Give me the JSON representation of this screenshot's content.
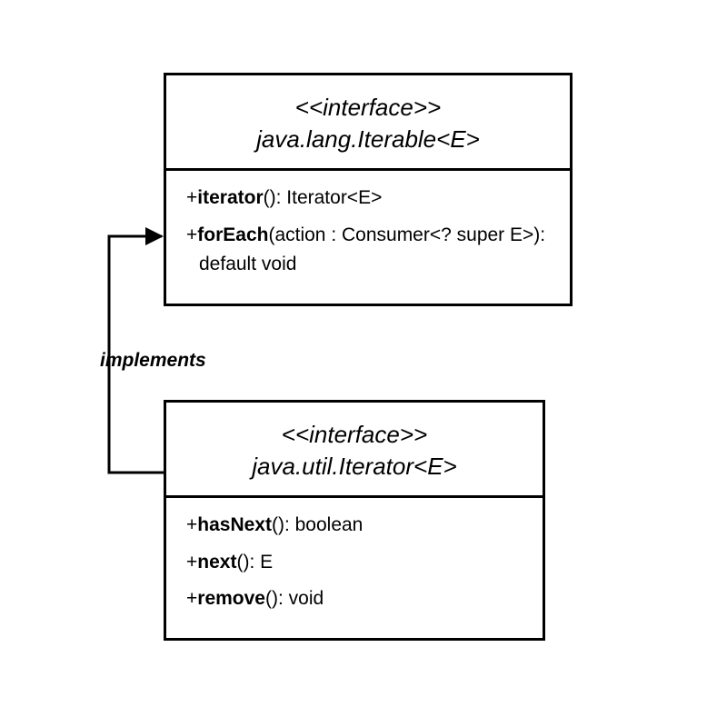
{
  "iterable": {
    "stereotype": "<<interface>>",
    "name": "java.lang.Iterable<E>",
    "methods": [
      {
        "prefix": "+",
        "name": "iterator",
        "sig": "(): Iterator<E>"
      },
      {
        "prefix": "+",
        "name": "forEach",
        "sig": "(action : Consumer<? super E>): default void"
      }
    ]
  },
  "iterator": {
    "stereotype": "<<interface>>",
    "name": "java.util.Iterator<E>",
    "methods": [
      {
        "prefix": "+",
        "name": "hasNext",
        "sig": "(): boolean"
      },
      {
        "prefix": "+",
        "name": "next",
        "sig": "(): E"
      },
      {
        "prefix": "+",
        "name": "remove",
        "sig": "(): void"
      }
    ]
  },
  "relationship": {
    "label": "implements"
  }
}
